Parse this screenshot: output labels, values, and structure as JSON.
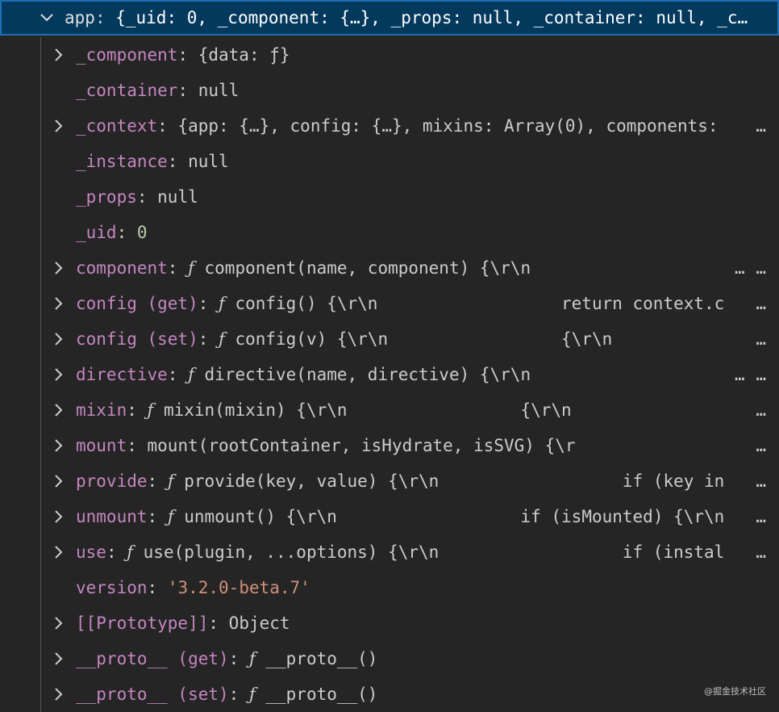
{
  "root": {
    "name": "app",
    "sep": ": ",
    "value": "{_uid: 0, _component: {…}, _props: null, _container: null, _c…",
    "expanded": true
  },
  "children": [
    {
      "name": "_component",
      "sep": ": ",
      "value": "{data: ƒ}",
      "expandable": true
    },
    {
      "name": "_container",
      "sep": ": ",
      "value": "null",
      "expandable": false
    },
    {
      "name": "_context",
      "sep": ": ",
      "value": "{app: {…}, config: {…}, mixins: Array(0), components: ",
      "expandable": true
    },
    {
      "name": "_instance",
      "sep": ": ",
      "value": "null",
      "expandable": false
    },
    {
      "name": "_props",
      "sep": ": ",
      "value": "null",
      "expandable": false
    },
    {
      "name": "_uid",
      "sep": ": ",
      "value": "0",
      "expandable": false,
      "kind": "num"
    },
    {
      "name": "component",
      "sep": ": ",
      "value": "ƒ component(name, component) {\\r\\n                           {",
      "expandable": true
    },
    {
      "name": "config (get)",
      "sep": ": ",
      "value": "ƒ config() {\\r\\n                  return context.c",
      "expandable": true
    },
    {
      "name": "config (set)",
      "sep": ": ",
      "value": "ƒ config(v) {\\r\\n                 {\\r\\n          ",
      "expandable": true
    },
    {
      "name": "directive",
      "sep": ": ",
      "value": "ƒ directive(name, directive) {\\r\\n                           {",
      "expandable": true
    },
    {
      "name": "mixin",
      "sep": ": ",
      "value": "ƒ mixin(mixin) {\\r\\n                 {\\r\\n          ",
      "expandable": true
    },
    {
      "name": "mount",
      "sep": ": ",
      "value": "mount(rootContainer, isHydrate, isSVG) {\\r           ",
      "expandable": true
    },
    {
      "name": "provide",
      "sep": ": ",
      "value": "ƒ provide(key, value) {\\r\\n                  if (key in",
      "expandable": true
    },
    {
      "name": "unmount",
      "sep": ": ",
      "value": "ƒ unmount() {\\r\\n                  if (isMounted) {\\r\\n",
      "expandable": true
    },
    {
      "name": "use",
      "sep": ": ",
      "value": "ƒ use(plugin, ...options) {\\r\\n                  if (instal",
      "expandable": true
    },
    {
      "name": "version",
      "sep": ": ",
      "value": "'3.2.0-beta.7'",
      "expandable": false,
      "kind": "str"
    },
    {
      "name": "[[Prototype]]",
      "sep": ": ",
      "value": "Object",
      "expandable": true
    },
    {
      "name": "__proto__ (get)",
      "sep": ": ",
      "value": "ƒ __proto__()",
      "expandable": true
    },
    {
      "name": "__proto__ (set)",
      "sep": ": ",
      "value": "ƒ __proto__()",
      "expandable": true
    }
  ],
  "ellipsis": "…",
  "watermark": "@掘金技术社区",
  "colors": {
    "background": "#252526",
    "selection": "#04395e",
    "selection_border": "#1f6fb5",
    "property_name": "#c586c0",
    "number": "#b5cea8",
    "string": "#ce9178",
    "text": "#cccccc"
  }
}
